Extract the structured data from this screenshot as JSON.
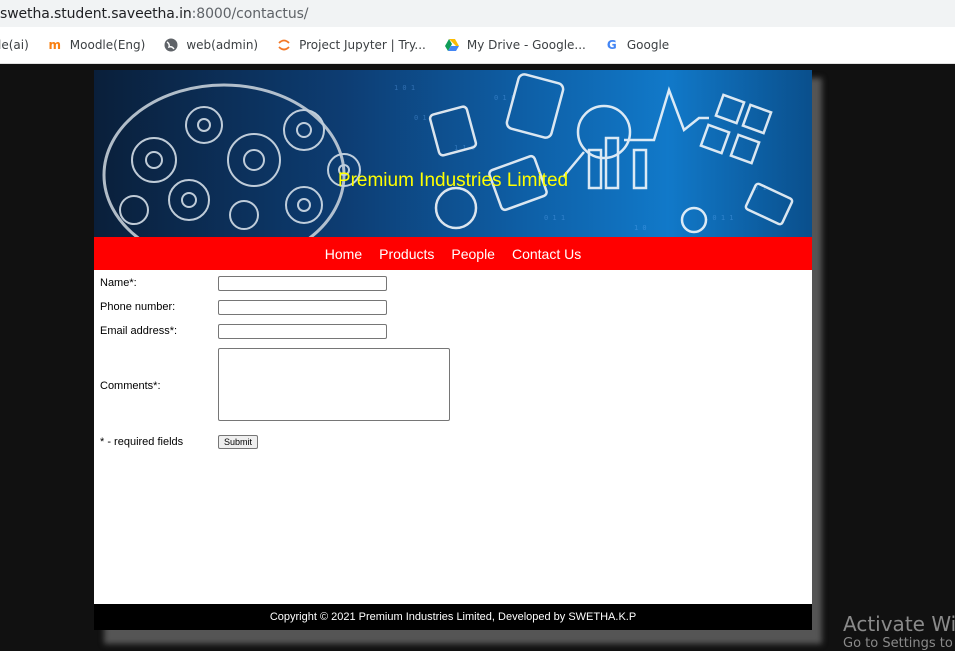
{
  "browser": {
    "url_main": "swetha.student.saveetha.in",
    "url_rest": ":8000/contactus/",
    "bookmarks": [
      {
        "label": "le(ai)",
        "icon": "none"
      },
      {
        "label": "Moodle(Eng)",
        "icon": "moodle-icon"
      },
      {
        "label": "web(admin)",
        "icon": "globe-icon"
      },
      {
        "label": "Project Jupyter | Try...",
        "icon": "jupyter-icon"
      },
      {
        "label": "My Drive - Google...",
        "icon": "google-drive-icon"
      },
      {
        "label": "Google",
        "icon": "google-icon"
      }
    ]
  },
  "site": {
    "title": "Premium Industries Limited",
    "nav": [
      "Home",
      "Products",
      "People",
      "Contact Us"
    ],
    "form": {
      "name_label": "Name*:",
      "phone_label": "Phone number:",
      "email_label": "Email address*:",
      "comments_label": "Comments*:",
      "required_note": "* - required fields",
      "submit_label": "Submit"
    },
    "footer": "Copyright © 2021 Premium Industries Limited, Developed by SWETHA.K.P"
  },
  "os": {
    "watermark": "Activate Win",
    "watermark_sub": "Go to Settings to"
  },
  "colors": {
    "banner_title": "#ffff00",
    "navbar": "#ff0000",
    "footer": "#000000"
  }
}
